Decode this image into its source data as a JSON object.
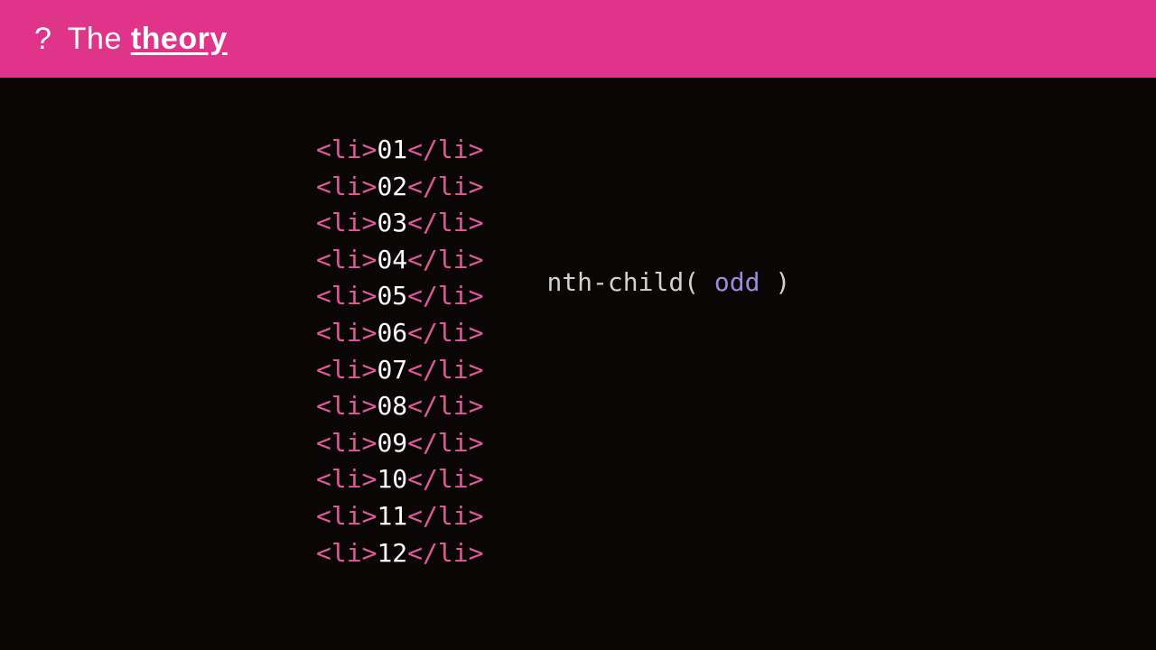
{
  "header": {
    "question": "?",
    "the": "The",
    "theory": "theory"
  },
  "code": {
    "items": [
      "01",
      "02",
      "03",
      "04",
      "05",
      "06",
      "07",
      "08",
      "09",
      "10",
      "11",
      "12"
    ],
    "open_tag": "<li>",
    "close_tag": "</li>"
  },
  "selector": {
    "fn_open": "nth-child( ",
    "arg": "odd",
    "fn_close": " )"
  }
}
